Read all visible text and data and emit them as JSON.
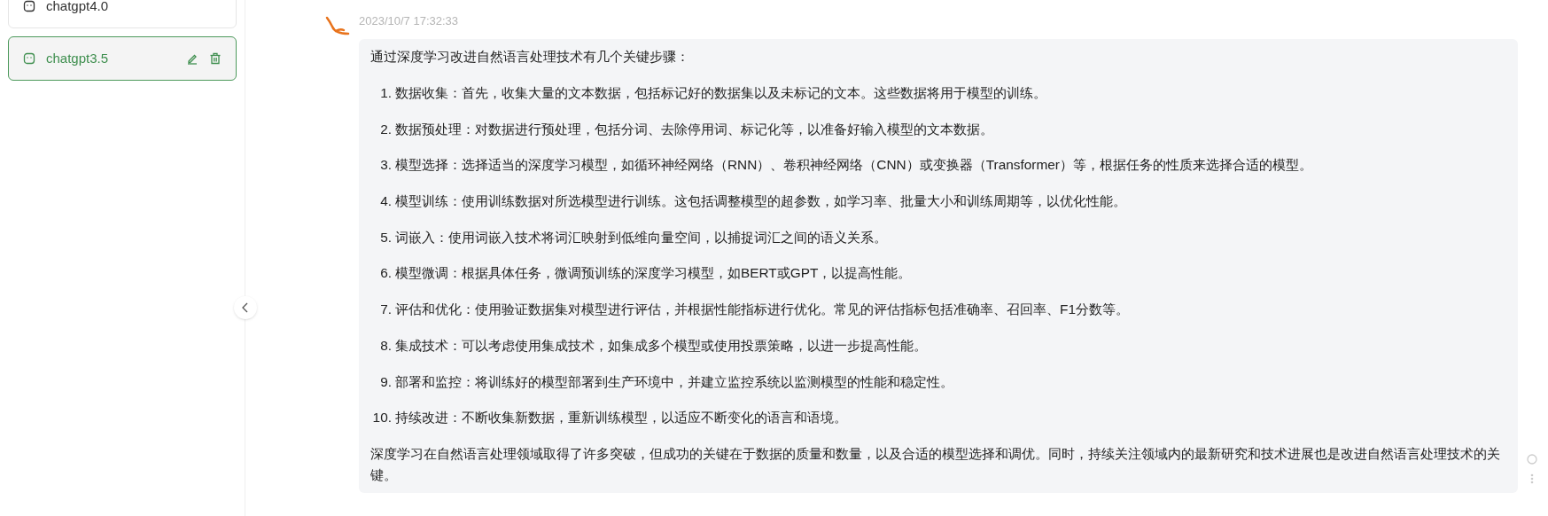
{
  "sidebar": {
    "items": [
      {
        "label": "chatgpt4.0",
        "selected": false
      },
      {
        "label": "chatgpt3.5",
        "selected": true
      }
    ]
  },
  "message": {
    "timestamp": "2023/10/7 17:32:33",
    "intro": "通过深度学习改进自然语言处理技术有几个关键步骤：",
    "steps": [
      {
        "number": "1.",
        "text": "数据收集：首先，收集大量的文本数据，包括标记好的数据集以及未标记的文本。这些数据将用于模型的训练。"
      },
      {
        "number": "2.",
        "text": "数据预处理：对数据进行预处理，包括分词、去除停用词、标记化等，以准备好输入模型的文本数据。"
      },
      {
        "number": "3.",
        "text": "模型选择：选择适当的深度学习模型，如循环神经网络（RNN）、卷积神经网络（CNN）或变换器（Transformer）等，根据任务的性质来选择合适的模型。"
      },
      {
        "number": "4.",
        "text": "模型训练：使用训练数据对所选模型进行训练。这包括调整模型的超参数，如学习率、批量大小和训练周期等，以优化性能。"
      },
      {
        "number": "5.",
        "text": "词嵌入：使用词嵌入技术将词汇映射到低维向量空间，以捕捉词汇之间的语义关系。"
      },
      {
        "number": "6.",
        "text": "模型微调：根据具体任务，微调预训练的深度学习模型，如BERT或GPT，以提高性能。"
      },
      {
        "number": "7.",
        "text": "评估和优化：使用验证数据集对模型进行评估，并根据性能指标进行优化。常见的评估指标包括准确率、召回率、F1分数等。"
      },
      {
        "number": "8.",
        "text": "集成技术：可以考虑使用集成技术，如集成多个模型或使用投票策略，以进一步提高性能。"
      },
      {
        "number": "9.",
        "text": "部署和监控：将训练好的模型部署到生产环境中，并建立监控系统以监测模型的性能和稳定性。"
      },
      {
        "number": "10.",
        "text": "持续改进：不断收集新数据，重新训练模型，以适应不断变化的语言和语境。"
      }
    ],
    "conclusion": "深度学习在自然语言处理领域取得了许多突破，但成功的关键在于数据的质量和数量，以及合适的模型选择和调优。同时，持续关注领域内的最新研究和技术进展也是改进自然语言处理技术的关键。"
  }
}
